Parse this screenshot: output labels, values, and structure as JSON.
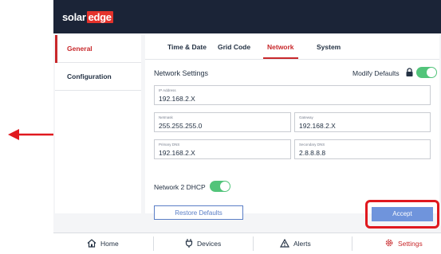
{
  "brand": {
    "part1": "solar",
    "part2": "edge"
  },
  "sidebar": {
    "items": [
      {
        "label": "General",
        "active": true
      },
      {
        "label": "Configuration",
        "active": false
      }
    ]
  },
  "tabs": [
    {
      "label": "Time & Date"
    },
    {
      "label": "Grid Code"
    },
    {
      "label": "Network",
      "active": true
    },
    {
      "label": "System"
    }
  ],
  "network": {
    "title": "Network Settings",
    "modify_defaults_label": "Modify Defaults",
    "modify_defaults_on": true,
    "fields": {
      "ip": {
        "label": "IP Address",
        "value": "192.168.2.X"
      },
      "netmask": {
        "label": "Netmask",
        "value": "255.255.255.0"
      },
      "gateway": {
        "label": "Gateway",
        "value": "192.168.2.X"
      },
      "primary_dns": {
        "label": "Primary DNS",
        "value": "192.168.2.X"
      },
      "secondary_dns": {
        "label": "Secondary DNS",
        "value": "2.8.8.8.8"
      }
    },
    "dhcp_label": "Network 2 DHCP",
    "dhcp_on": true
  },
  "buttons": {
    "restore": "Restore Defaults",
    "accept": "Accept"
  },
  "bottom_nav": [
    {
      "label": "Home",
      "icon": "home-icon"
    },
    {
      "label": "Devices",
      "icon": "plug-icon"
    },
    {
      "label": "Alerts",
      "icon": "alert-icon"
    },
    {
      "label": "Settings",
      "icon": "gear-icon",
      "active": true
    }
  ],
  "colors": {
    "accent": "#c8282b",
    "toggle_on": "#52c47a",
    "primary_button": "#6f94dc",
    "highlight_ring": "#e0191f",
    "header": "#1b2437"
  }
}
